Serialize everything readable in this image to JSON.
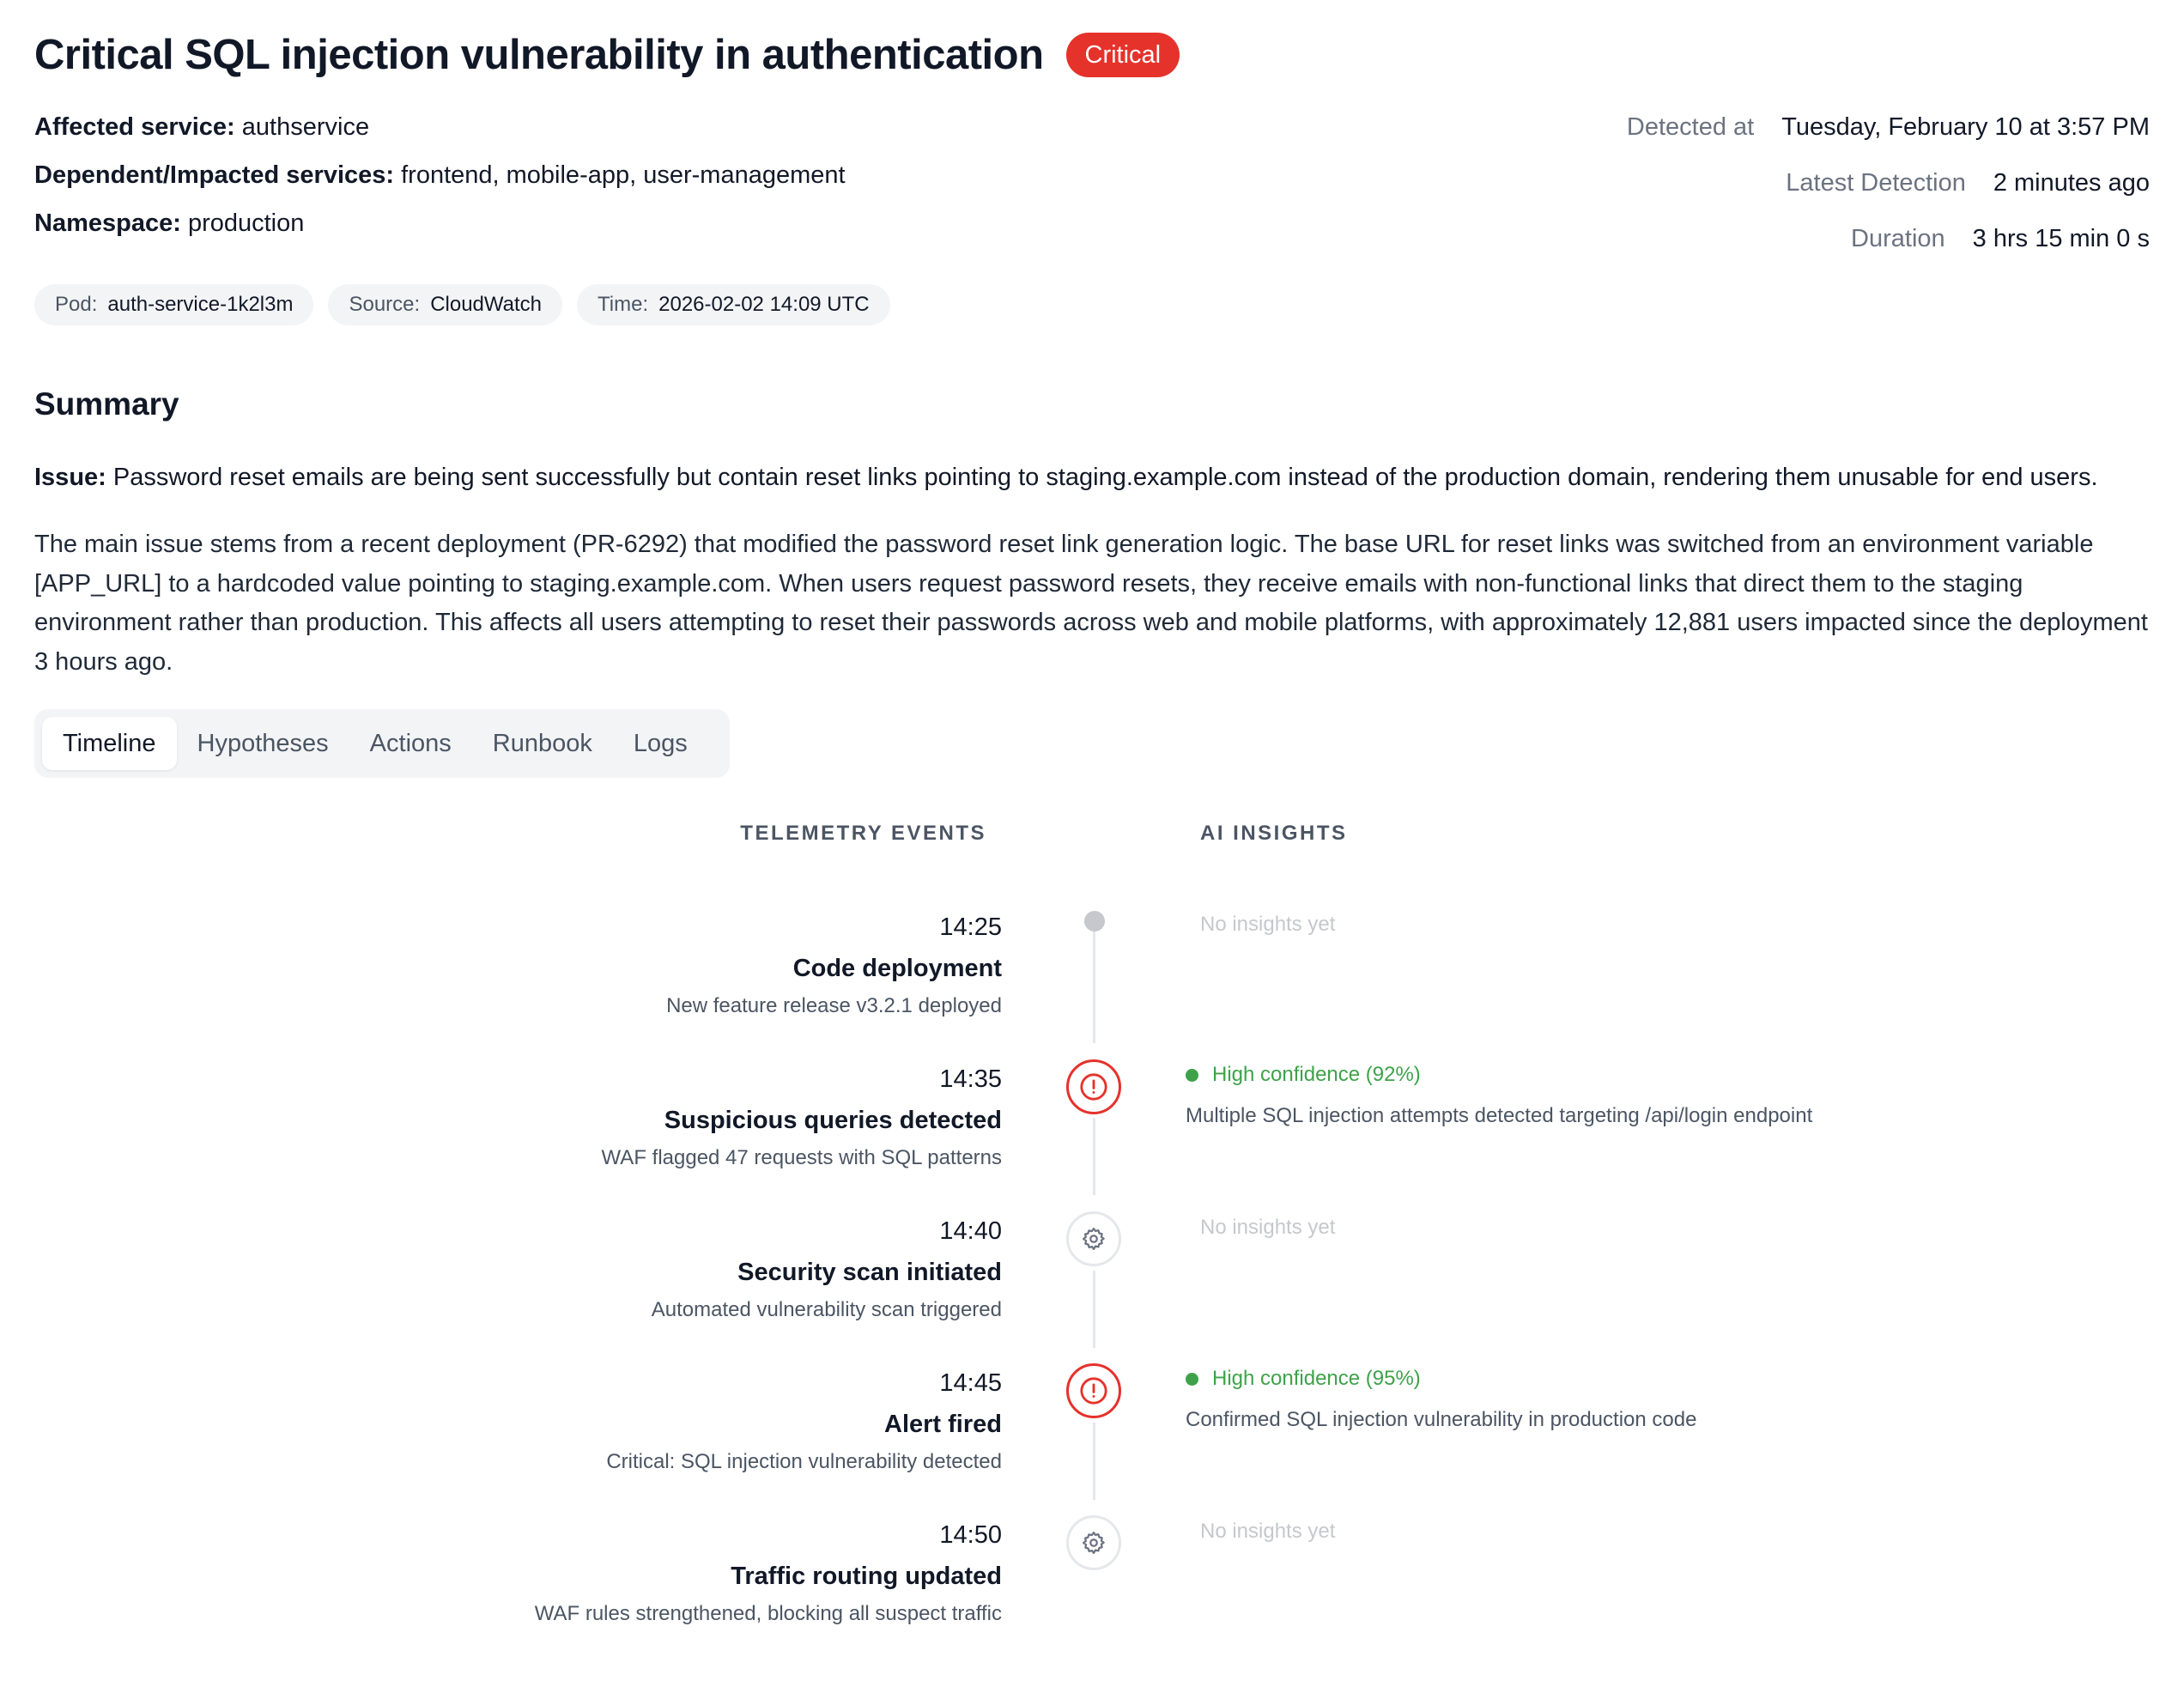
{
  "header": {
    "title": "Critical SQL injection vulnerability in authentication",
    "severity": "Critical",
    "severity_color": "#e5322b"
  },
  "meta": {
    "affected_label": "Affected service:",
    "affected_value": "authservice",
    "dependent_label": "Dependent/Impacted services:",
    "dependent_value": "frontend, mobile-app, user-management",
    "namespace_label": "Namespace:",
    "namespace_value": "production"
  },
  "detection": {
    "detected_at_label": "Detected at",
    "detected_at_value": "Tuesday, February 10 at 3:57 PM",
    "latest_label": "Latest Detection",
    "latest_value": "2 minutes ago",
    "duration_label": "Duration",
    "duration_value": "3 hrs 15 min 0 s"
  },
  "chips": [
    {
      "key": "Pod:",
      "value": "auth-service-1k2l3m"
    },
    {
      "key": "Source:",
      "value": "CloudWatch"
    },
    {
      "key": "Time:",
      "value": "2026-02-02 14:09 UTC"
    }
  ],
  "summary": {
    "heading": "Summary",
    "issue_label": "Issue:",
    "issue_text": "Password reset emails are being sent successfully but contain reset links pointing to staging.example.com instead of the production domain, rendering them unusable for end users.",
    "paragraph": "The main issue stems from a recent deployment (PR-6292) that modified the password reset link generation logic. The base URL for reset links was switched from an environment variable [APP_URL] to a hardcoded value pointing to staging.example.com. When users request password resets, they receive emails with non-functional links that direct them to the staging environment rather than production. This affects all users attempting to reset their passwords across web and mobile platforms, with approximately 12,881 users impacted since the deployment 3 hours ago."
  },
  "tabs": [
    {
      "label": "Timeline",
      "active": true
    },
    {
      "label": "Hypotheses",
      "active": false
    },
    {
      "label": "Actions",
      "active": false
    },
    {
      "label": "Runbook",
      "active": false
    },
    {
      "label": "Logs",
      "active": false
    }
  ],
  "timeline": {
    "telemetry_heading": "TELEMETRY EVENTS",
    "insights_heading": "AI INSIGHTS",
    "events": [
      {
        "time": "14:25",
        "title": "Code deployment",
        "desc": "New feature release v3.2.1 deployed",
        "icon": "dot-icon",
        "insight": null,
        "no_insight": "No insights yet"
      },
      {
        "time": "14:35",
        "title": "Suspicious queries detected",
        "desc": "WAF flagged 47 requests with SQL patterns",
        "icon": "alert-circle-icon",
        "insight": {
          "confidence": "High confidence (92%)",
          "text": "Multiple SQL injection attempts detected targeting /api/login endpoint"
        }
      },
      {
        "time": "14:40",
        "title": "Security scan initiated",
        "desc": "Automated vulnerability scan triggered",
        "icon": "gear-icon",
        "insight": null,
        "no_insight": "No insights yet"
      },
      {
        "time": "14:45",
        "title": "Alert fired",
        "desc": "Critical: SQL injection vulnerability detected",
        "icon": "alert-circle-icon",
        "insight": {
          "confidence": "High confidence (95%)",
          "text": "Confirmed SQL injection vulnerability in production code"
        }
      },
      {
        "time": "14:50",
        "title": "Traffic routing updated",
        "desc": "WAF rules strengthened, blocking all suspect traffic",
        "icon": "gear-icon",
        "insight": null,
        "no_insight": "No insights yet"
      }
    ],
    "confidence_color": "#3ea24a"
  }
}
